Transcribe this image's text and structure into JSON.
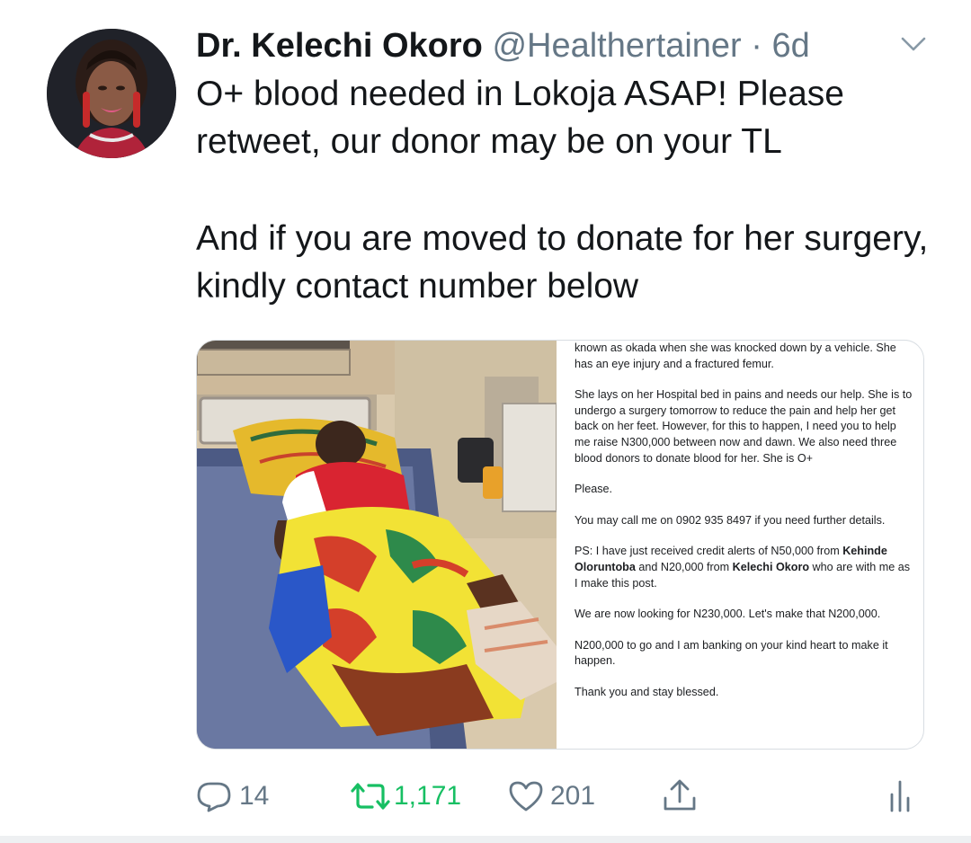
{
  "tweet": {
    "author_name": "Dr. Kelechi Okoro",
    "handle": "@Healthertainer",
    "time": "· 6d",
    "text_line1": "O+ blood needed in Lokoja ASAP! Please retweet, our donor may be on your TL",
    "text_line2": "And if you are moved to donate for her surgery, kindly contact number below"
  },
  "post_image": {
    "p1": "known as okada when she was knocked down by a vehicle. She has an eye injury and a fractured femur.",
    "p2": "She lays on her Hospital bed in pains and needs our help. She is to undergo a surgery tomorrow to reduce the pain and help her get back on her feet. However, for this to happen, I need you to help me raise N300,000 between now and dawn. We also need three blood donors to donate blood for her. She is O+",
    "p3": "Please.",
    "p4": "You may call me on 0902 935 8497 if you need further details.",
    "p5_a": "PS: I have just received credit alerts of N50,000 from ",
    "p5_b": "Kehinde Oloruntoba",
    "p5_c": " and N20,000 from ",
    "p5_d": "Kelechi Okoro",
    "p5_e": " who are with me as I make this post.",
    "p6": "We are now looking for N230,000. Let's make that N200,000.",
    "p7": "N200,000 to go and I am banking on your kind heart to make it happen.",
    "p8": "Thank you and stay blessed."
  },
  "actions": {
    "reply_count": "14",
    "retweet_count": "1,171",
    "like_count": "201"
  },
  "colors": {
    "retweet_green": "#17bf63",
    "icon_gray": "#657786",
    "text": "#14171a"
  },
  "icons": [
    "chevron-down-icon",
    "reply-icon",
    "retweet-icon",
    "like-icon",
    "share-icon",
    "analytics-icon"
  ]
}
